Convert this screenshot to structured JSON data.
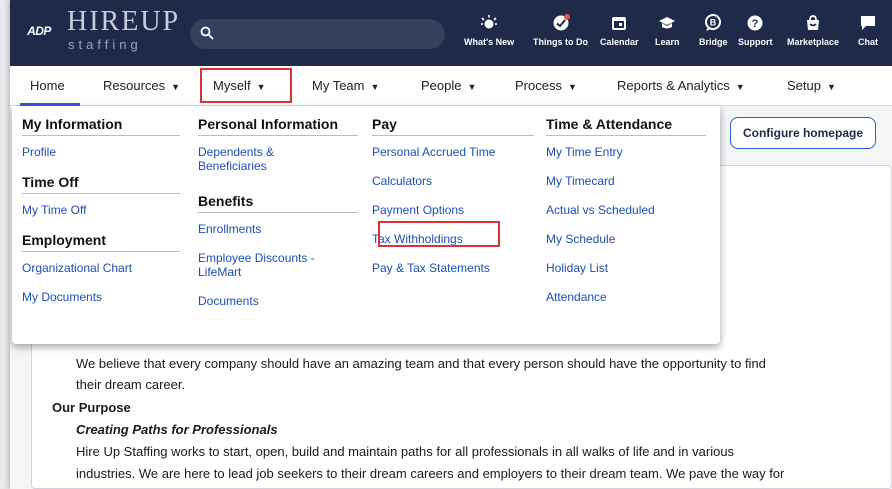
{
  "brand": {
    "adp": "ADP",
    "main": "HIREUP",
    "sub": "staffing"
  },
  "header_nav": [
    {
      "label": "What's New",
      "icon": "whats-new-icon"
    },
    {
      "label": "Things to Do",
      "icon": "things-to-do-icon"
    },
    {
      "label": "Calendar",
      "icon": "calendar-icon"
    },
    {
      "label": "Learn",
      "icon": "learn-icon"
    },
    {
      "label": "Bridge",
      "icon": "bridge-icon"
    },
    {
      "label": "Support",
      "icon": "support-icon"
    },
    {
      "label": "Marketplace",
      "icon": "marketplace-icon"
    },
    {
      "label": "Chat",
      "icon": "chat-icon"
    }
  ],
  "menu": {
    "home": "Home",
    "resources": "Resources",
    "myself": "Myself",
    "my_team": "My Team",
    "people": "People",
    "process": "Process",
    "reports": "Reports & Analytics",
    "setup": "Setup"
  },
  "dropdown": {
    "my_information": {
      "title": "My Information",
      "items": [
        "Profile"
      ]
    },
    "time_off": {
      "title": "Time Off",
      "items": [
        "My Time Off"
      ]
    },
    "employment": {
      "title": "Employment",
      "items": [
        "Organizational Chart",
        "My Documents"
      ]
    },
    "personal_information": {
      "title": "Personal Information",
      "items": [
        "Dependents & Beneficiaries"
      ]
    },
    "benefits": {
      "title": "Benefits",
      "items": [
        "Enrollments",
        "Employee Discounts - LifeMart",
        "Documents"
      ]
    },
    "pay": {
      "title": "Pay",
      "items": [
        "Personal Accrued Time",
        "Calculators",
        "Payment Options",
        "Tax Withholdings",
        "Pay & Tax Statements"
      ]
    },
    "time_attendance": {
      "title": "Time & Attendance",
      "items": [
        "My Time Entry",
        "My Timecard",
        "Actual vs Scheduled",
        "My Schedule",
        "Holiday List",
        "Attendance"
      ]
    }
  },
  "configure_button": "Configure homepage",
  "content": {
    "line1": "We believe that every company should have an amazing team and that every person should have the opportunity to find",
    "line2": "their dream career.",
    "purpose_heading": "Our Purpose",
    "purpose_sub": "Creating Paths for Professionals",
    "line3": "Hire Up Staffing works to start, open, build and maintain paths for all professionals in all walks of life and in various",
    "line4": "industries. We are here to lead job seekers to their dream careers and employers to their dream team. We pave the way for"
  },
  "colors": {
    "header_bg": "#1f2a4a",
    "link": "#1d4fb8",
    "highlight": "#d83434",
    "accent": "#2e5bd0"
  }
}
